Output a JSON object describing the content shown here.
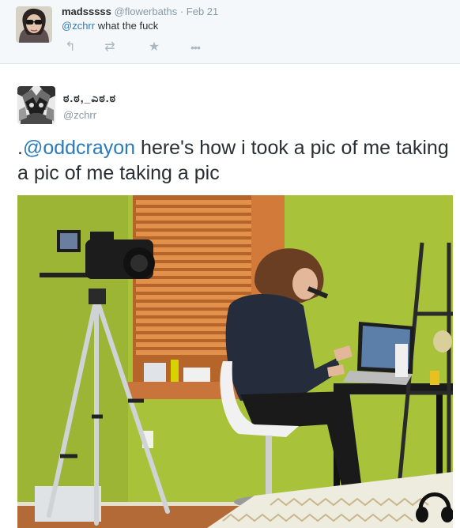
{
  "reply_tweet": {
    "name": "madsssss",
    "handle": "@flowerbaths",
    "separator": "·",
    "time": "Feb 21",
    "mention": "@zchrr",
    "text": " what the fuck",
    "actions": [
      {
        "name": "reply-icon",
        "glyph": "↰"
      },
      {
        "name": "retweet-icon",
        "glyph": "⇄"
      },
      {
        "name": "favorite-icon",
        "glyph": "★"
      },
      {
        "name": "more-icon",
        "glyph": "•••"
      }
    ]
  },
  "main_tweet": {
    "name": "ಠ.ಠ,_ಎಠ.ಠ",
    "handle": "@zchrr",
    "text_prefix": ".",
    "mention": "@oddcrayon",
    "text": " here's how i took a pic of me taking a pic of me taking a pic"
  },
  "colors": {
    "link": "#2b7bb9",
    "muted": "#8899a6",
    "text": "#292f33",
    "wall": "#a8c23a"
  }
}
